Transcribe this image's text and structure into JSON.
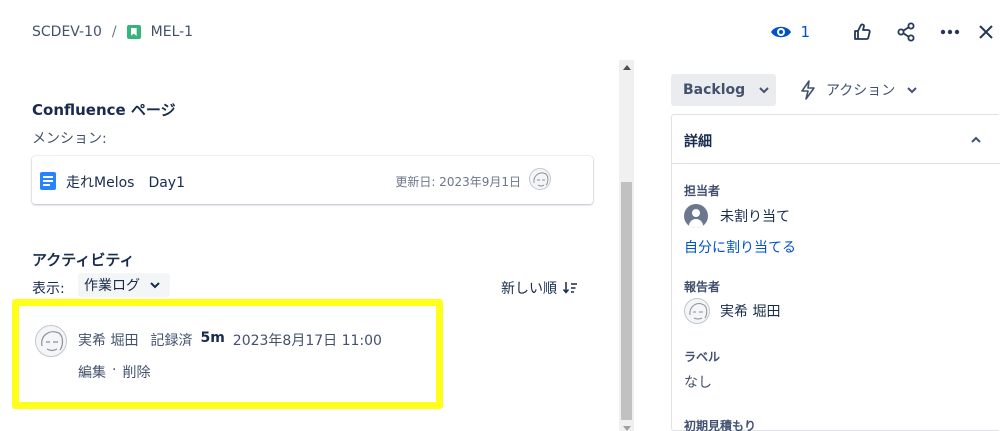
{
  "breadcrumb": {
    "project": "SCDEV-10",
    "separator": "/",
    "issue_key": "MEL-1"
  },
  "header": {
    "watch_count": "1"
  },
  "confluence": {
    "title": "Confluence ページ",
    "mention_label": "メンション:",
    "page_title": "走れMelos　Day1",
    "updated": "更新日: 2023年9月1日"
  },
  "activity": {
    "title": "アクティビティ",
    "show_label": "表示:",
    "show_value": "作業ログ",
    "sort_label": "新しい順",
    "worklog": {
      "user": "実希 堀田",
      "action": "記録済",
      "duration": "5m",
      "datetime": "2023年8月17日 11:00",
      "edit": "編集",
      "dot": "·",
      "delete": "削除"
    }
  },
  "sidebar": {
    "status": "Backlog",
    "actions": "アクション",
    "details_title": "詳細",
    "assignee_label": "担当者",
    "assignee_value": "未割り当て",
    "assign_to_me": "自分に割り当てる",
    "reporter_label": "報告者",
    "reporter_value": "実希 堀田",
    "labels_label": "ラベル",
    "labels_value": "なし",
    "estimate_label": "初期見積もり"
  },
  "colors": {
    "highlight": "#ffff1a",
    "link": "#0052cc",
    "story": "#36b37e",
    "doc": "#2684ff"
  },
  "icons": [
    "story-icon",
    "eye-icon",
    "thumbs-up-icon",
    "share-icon",
    "more-icon",
    "close-icon",
    "document-icon",
    "sort-icon",
    "chevron-down-icon",
    "lightning-icon",
    "chevron-up-icon",
    "avatar",
    "unassigned-avatar"
  ]
}
